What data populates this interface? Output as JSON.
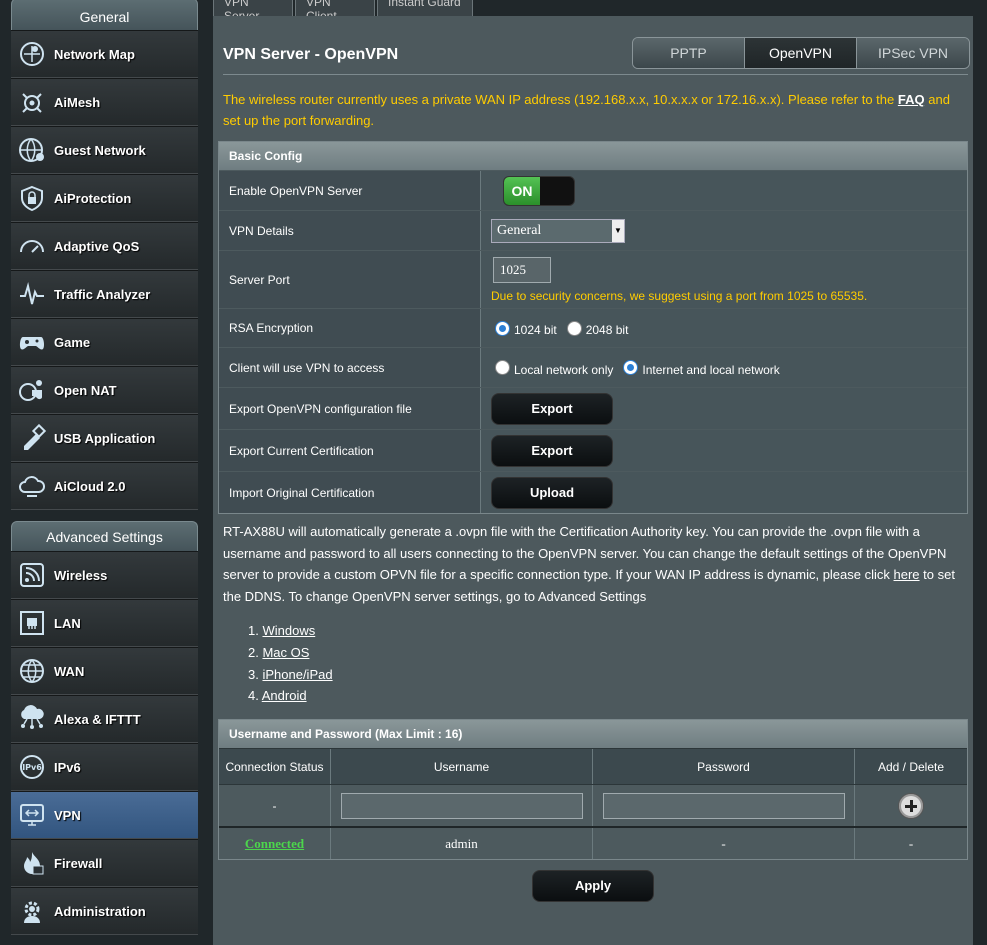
{
  "top_tabs": [
    "VPN Server",
    "VPN Client",
    "Instant Guard"
  ],
  "sidebar": {
    "general_header": "General",
    "general_items": [
      {
        "label": "Network Map",
        "icon": "network-map-icon"
      },
      {
        "label": "AiMesh",
        "icon": "aimesh-icon"
      },
      {
        "label": "Guest Network",
        "icon": "guest-network-icon"
      },
      {
        "label": "AiProtection",
        "icon": "shield-lock-icon"
      },
      {
        "label": "Adaptive QoS",
        "icon": "speedometer-icon"
      },
      {
        "label": "Traffic Analyzer",
        "icon": "traffic-analyzer-icon"
      },
      {
        "label": "Game",
        "icon": "gamepad-icon"
      },
      {
        "label": "Open NAT",
        "icon": "open-nat-icon"
      },
      {
        "label": "USB Application",
        "icon": "usb-icon"
      },
      {
        "label": "AiCloud 2.0",
        "icon": "cloud-icon"
      }
    ],
    "advanced_header": "Advanced Settings",
    "advanced_items": [
      {
        "label": "Wireless",
        "icon": "wifi-icon"
      },
      {
        "label": "LAN",
        "icon": "lan-icon"
      },
      {
        "label": "WAN",
        "icon": "globe-icon"
      },
      {
        "label": "Alexa & IFTTT",
        "icon": "alexa-icon"
      },
      {
        "label": "IPv6",
        "icon": "ipv6-icon"
      },
      {
        "label": "VPN",
        "icon": "vpn-icon"
      },
      {
        "label": "Firewall",
        "icon": "firewall-icon"
      },
      {
        "label": "Administration",
        "icon": "gear-icon"
      }
    ]
  },
  "page": {
    "title": "VPN Server - OpenVPN",
    "proto_tabs": [
      "PPTP",
      "OpenVPN",
      "IPSec VPN"
    ],
    "notice_text": "The wireless router currently uses a private WAN IP address (192.168.x.x, 10.x.x.x or 172.16.x.x). Please refer to the",
    "notice_link": "FAQ",
    "notice_tail": "and set up the port forwarding."
  },
  "basic_config": {
    "header": "Basic Config",
    "enable_label": "Enable OpenVPN Server",
    "enable_state": "ON",
    "details_label": "VPN Details",
    "details_value": "General",
    "port_label": "Server Port",
    "port_value": "1025",
    "port_hint": "Due to security concerns, we suggest using a port from 1025 to 65535.",
    "rsa_label": "RSA Encryption",
    "rsa_opt1": "1024 bit",
    "rsa_opt2": "2048 bit",
    "access_label": "Client will use VPN to access",
    "access_opt1": "Local network only",
    "access_opt2": "Internet and local network",
    "export_cfg_label": "Export OpenVPN configuration file",
    "export_cert_label": "Export Current Certification",
    "import_cert_label": "Import Original Certification",
    "export_btn": "Export",
    "upload_btn": "Upload"
  },
  "description": {
    "text": "RT-AX88U will automatically generate a .ovpn file with the Certification Authority key. You can provide the .ovpn file with a username and password to all users connecting to the OpenVPN server. You can change the default settings of the OpenVPN server to provide a custom OPVN file for a specific connection type. If your WAN IP address is dynamic, please click",
    "link": "here",
    "tail": "to set the DDNS. To change OpenVPN server settings, go to Advanced Settings",
    "os_links": [
      "Windows",
      "Mac OS",
      "iPhone/iPad",
      "Android"
    ]
  },
  "users": {
    "header": "Username and Password (Max Limit : 16)",
    "columns": [
      "Connection Status",
      "Username",
      "Password",
      "Add / Delete"
    ],
    "input_status": "-",
    "rows": [
      {
        "status": "Connected",
        "username": "admin",
        "password": "-",
        "action": "-"
      }
    ]
  },
  "apply_label": "Apply"
}
